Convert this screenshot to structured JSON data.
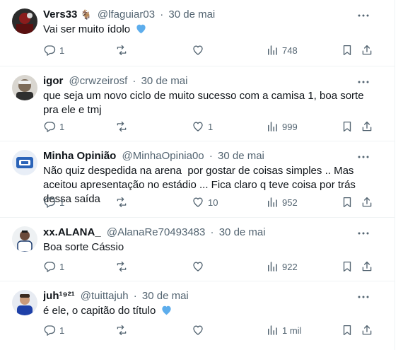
{
  "accent_color": "#1d9bf0",
  "text_color": "#0f1419",
  "muted_color": "#536471",
  "icons": {
    "reply": "reply-icon",
    "retweet": "retweet-icon",
    "like": "heart-icon",
    "views": "views-icon",
    "bookmark": "bookmark-icon",
    "share": "share-icon",
    "more": "more-icon"
  },
  "tweets": [
    {
      "name": "Vers33",
      "handle": "@lfaguiar03",
      "date": "30 de mai",
      "text": "Vai ser muito ídolo",
      "replies": "1",
      "retweets": "",
      "likes": "",
      "views": "748"
    },
    {
      "name": "igor",
      "handle": "@crwzeirosf",
      "date": "30 de mai",
      "text": "que seja um novo ciclo de muito sucesso com a camisa 1, boa sorte pra ele e tmj",
      "replies": "1",
      "retweets": "",
      "likes": "1",
      "views": "999"
    },
    {
      "name": "Minha Opinião",
      "handle": "@MinhaOpinia0o",
      "date": "30 de mai",
      "text": "Não quiz despedida na arena  por gostar de coisas simples .. Mas aceitou apresentação no estádio ... Fica claro q teve coisa por trás dessa saída",
      "replies": "1",
      "retweets": "",
      "likes": "10",
      "views": "952"
    },
    {
      "name": "xx.ALANA_",
      "handle": "@AlanaRe70493483",
      "date": "30 de mai",
      "text": "Boa sorte Cássio",
      "replies": "1",
      "retweets": "",
      "likes": "",
      "views": "922"
    },
    {
      "name": "juh¹⁹²¹",
      "handle": "@tuittajuh",
      "date": "30 de mai",
      "text": "é ele, o capitão do título",
      "replies": "1",
      "retweets": "",
      "likes": "",
      "views": "1 mil"
    }
  ]
}
